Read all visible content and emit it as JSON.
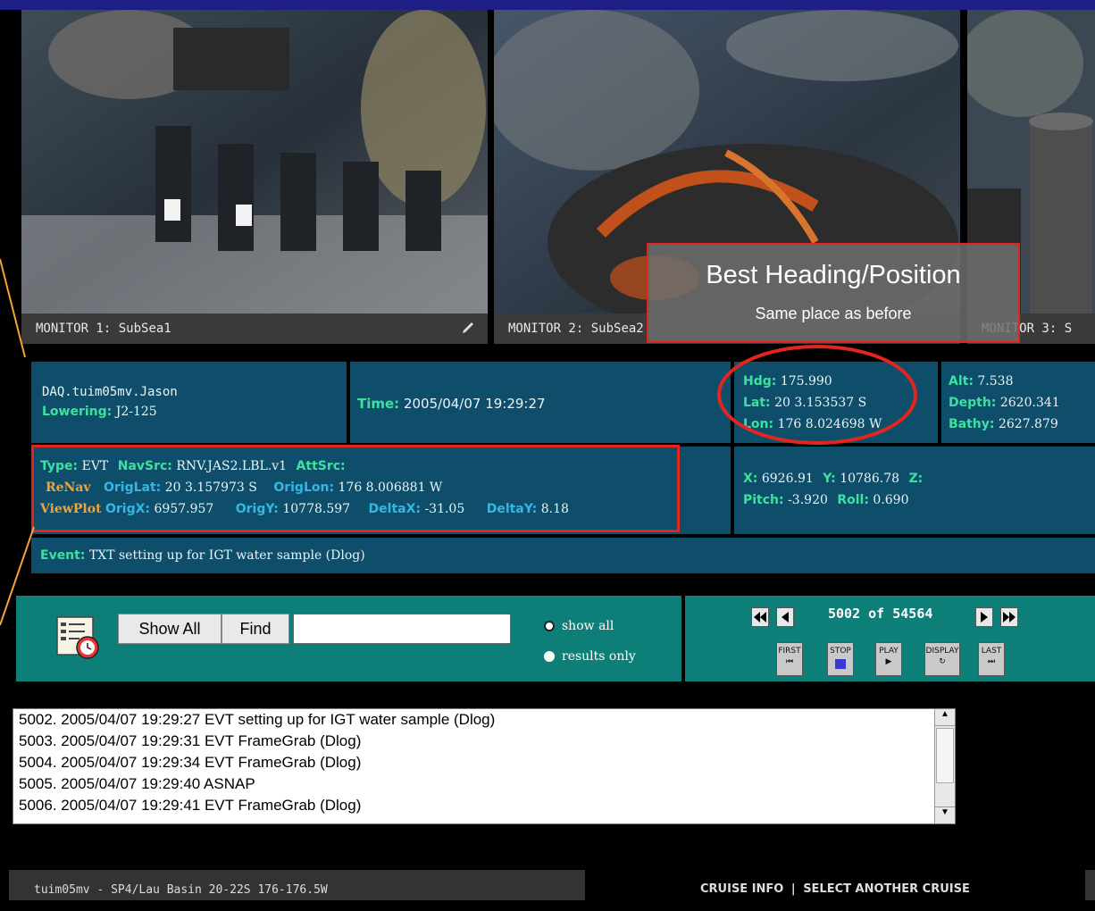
{
  "monitors": [
    {
      "label": "MONITOR 1:",
      "name": "SubSea1"
    },
    {
      "label": "MONITOR 2:",
      "name": "SubSea2"
    },
    {
      "label": "MONITOR 3:",
      "name": "S"
    }
  ],
  "callout": {
    "title": "Best Heading/Position",
    "subtitle": "Same place as before"
  },
  "info": {
    "dataset": "DAQ.tuim05mv.Jason",
    "lowering_label": "Lowering:",
    "lowering_value": "J2-125",
    "time_label": "Time:",
    "time_value": "2005/04/07 19:29:27",
    "hdg_label": "Hdg:",
    "hdg_value": "175.990",
    "lat_label": "Lat:",
    "lat_value": "20 3.153537 S",
    "lon_label": "Lon:",
    "lon_value": "176 8.024698 W",
    "alt_label": "Alt:",
    "alt_value": "7.538",
    "depth_label": "Depth:",
    "depth_value": "2620.341",
    "bathy_label": "Bathy:",
    "bathy_value": "2627.879",
    "type_label": "Type:",
    "type_value": "EVT",
    "navsrc_label": "NavSrc:",
    "navsrc_value": "RNV.JAS2.LBL.v1",
    "attsrc_label": "AttSrc:",
    "renav_link": "ReNav",
    "origlat_label": "OrigLat:",
    "origlat_value": "20 3.157973 S",
    "origlon_label": "OrigLon:",
    "origlon_value": "176 8.006881 W",
    "viewplot_link": "ViewPlot",
    "origx_label": "OrigX:",
    "origx_value": "6957.957",
    "origy_label": "OrigY:",
    "origy_value": "10778.597",
    "deltax_label": "DeltaX:",
    "deltax_value": "-31.05",
    "deltay_label": "DeltaY:",
    "deltay_value": "8.18",
    "x_label": "X:",
    "x_value": "6926.91",
    "y_label": "Y:",
    "y_value": "10786.78",
    "z_label": "Z:",
    "pitch_label": "Pitch:",
    "pitch_value": "-3.920",
    "roll_label": "Roll:",
    "roll_value": "0.690",
    "event_label": "Event:",
    "event_value": "TXT setting up for IGT water sample (Dlog)"
  },
  "search": {
    "show_all_label": "Show All",
    "find_label": "Find",
    "input_value": "",
    "radio_show_all": "show all",
    "radio_results_only": "results only"
  },
  "navigator": {
    "counter": "5002 of 54564",
    "first": "FIRST",
    "stop": "STOP",
    "play": "PLAY",
    "display": "DISPLAY",
    "last": "LAST"
  },
  "events": [
    "5002. 2005/04/07 19:29:27 EVT setting up for IGT water sample (Dlog)",
    "5003. 2005/04/07 19:29:31 EVT FrameGrab (Dlog)",
    "5004. 2005/04/07 19:29:34 EVT FrameGrab (Dlog)",
    "5005. 2005/04/07 19:29:40 ASNAP",
    "5006. 2005/04/07 19:29:41 EVT FrameGrab (Dlog)"
  ],
  "footer": {
    "cruise": "tuim05mv - SP4/Lau Basin 20-22S 176-176.5W",
    "cruise_info": "CRUISE INFO",
    "separator": "|",
    "select_cruise": "SELECT ANOTHER CRUISE"
  },
  "colors": {
    "accent_green": "#3ee0a0",
    "highlight_red": "#e0261f",
    "panel_blue": "#0f4e6b",
    "teal": "#0e7f78",
    "link_orange": "#f0a43a"
  }
}
